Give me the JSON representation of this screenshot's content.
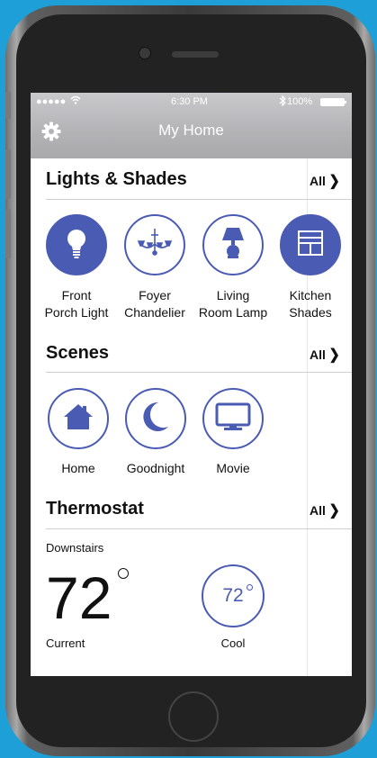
{
  "status_bar": {
    "signal": "●●●●● ",
    "time": "6:30 PM",
    "battery": "100%"
  },
  "header": {
    "title": "My Home"
  },
  "lights": {
    "title": "Lights & Shades",
    "all": "All",
    "items": [
      {
        "label1": "Front",
        "label2": "Porch Light",
        "icon": "bulb-icon"
      },
      {
        "label1": "Foyer",
        "label2": "Chandelier",
        "icon": "chandelier-icon"
      },
      {
        "label1": "Living",
        "label2": "Room Lamp",
        "icon": "lamp-icon"
      },
      {
        "label1": "Kitchen",
        "label2": "Shades",
        "icon": "shades-icon"
      }
    ]
  },
  "scenes": {
    "title": "Scenes",
    "all": "All",
    "items": [
      {
        "label": "Home",
        "icon": "house-icon"
      },
      {
        "label": "Goodnight",
        "icon": "moon-icon"
      },
      {
        "label": "Movie",
        "icon": "tv-icon"
      }
    ]
  },
  "thermostat": {
    "title": "Thermostat",
    "all": "All",
    "zone": "Downstairs",
    "current_temp": "72",
    "current_label": "Current",
    "setpoint": "72",
    "mode_label": "Cool"
  },
  "colors": {
    "accent": "#4a5bb3",
    "background": "#1e9fd8"
  }
}
